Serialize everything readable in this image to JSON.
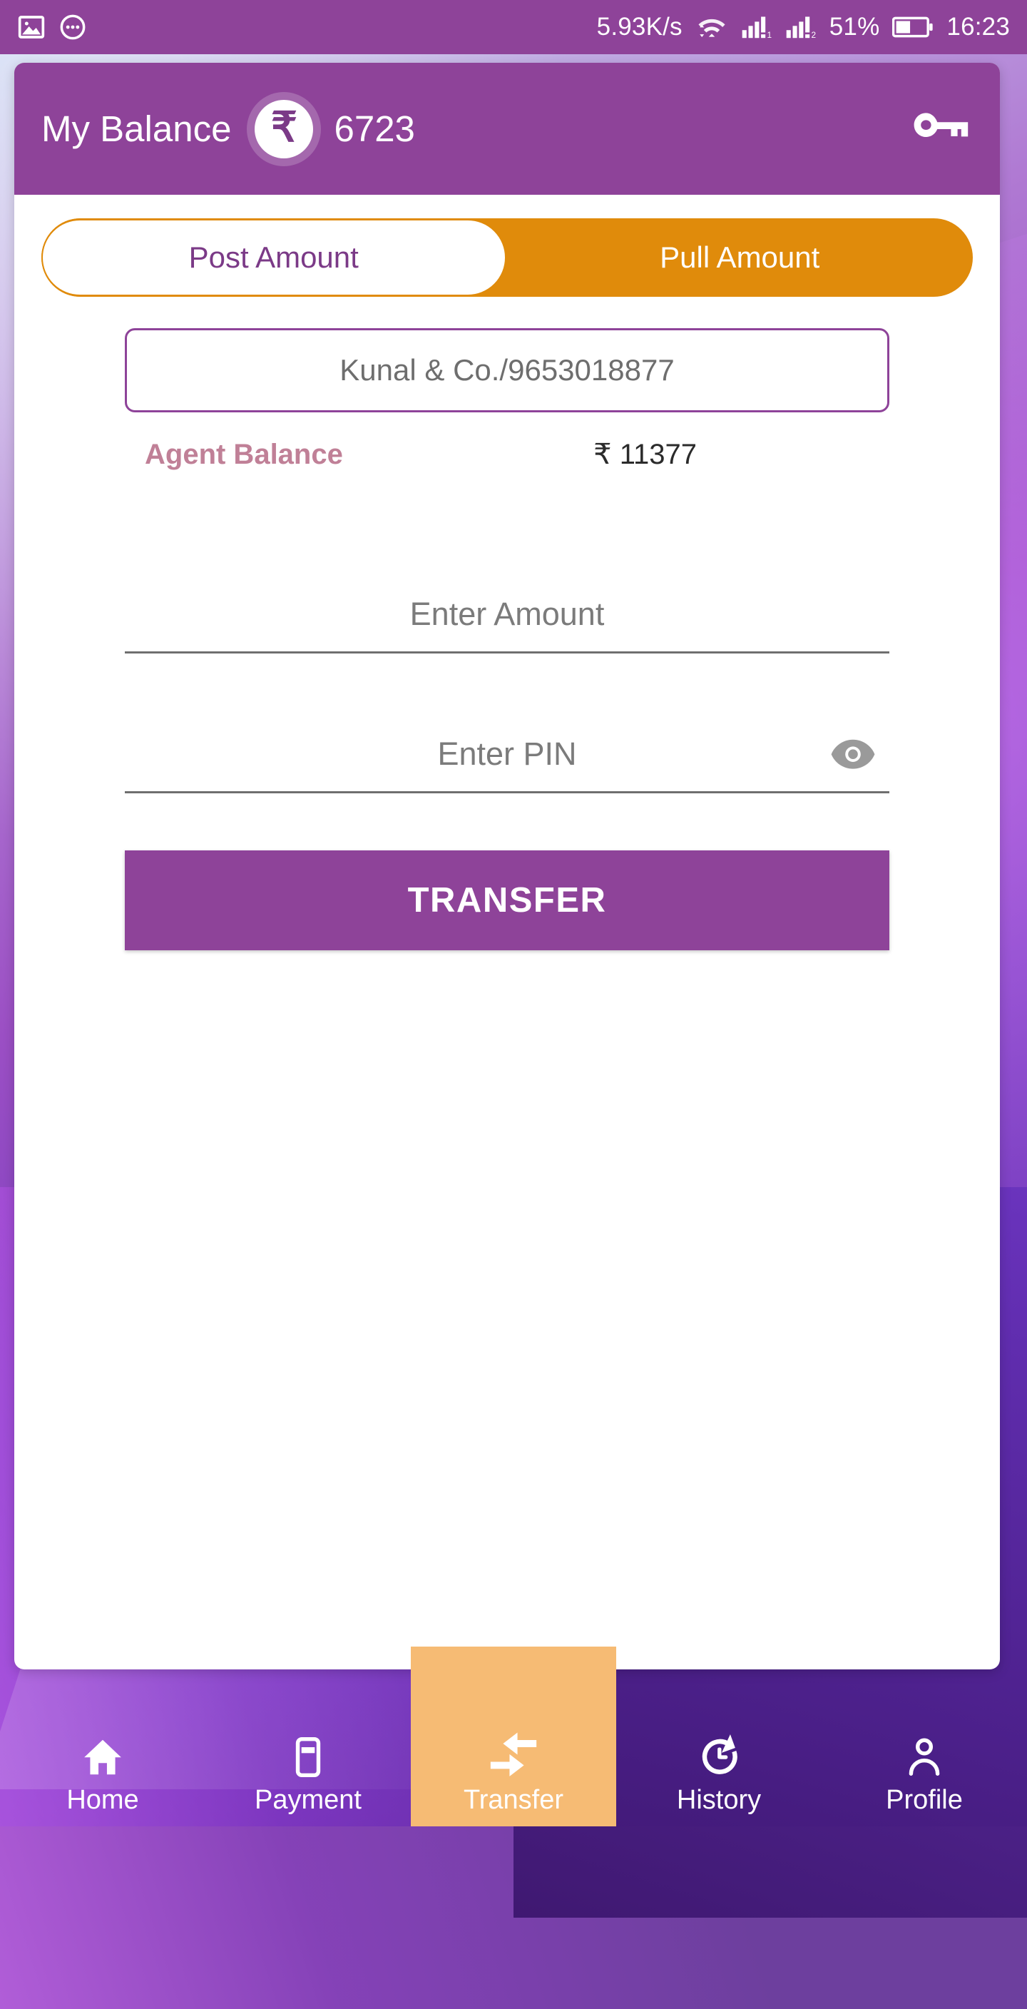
{
  "statusbar": {
    "network_speed": "5.93K/s",
    "battery_percent": "51%",
    "clock": "16:23",
    "icons": {
      "screenshot": "image-icon",
      "more": "more-circle-icon",
      "wifi": "wifi-icon",
      "signal1": "signal-bars-sim1-icon",
      "signal2": "signal-bars-sim2-icon",
      "battery": "battery-half-icon"
    }
  },
  "appbar": {
    "title": "My Balance",
    "currency_symbol": "₹",
    "balance": "6723",
    "key_icon": "key-icon",
    "accent": "#8e4399"
  },
  "tabs": {
    "items": [
      {
        "label": "Post Amount",
        "active": true
      },
      {
        "label": "Pull Amount",
        "active": false
      }
    ],
    "track_color": "#e08b0b",
    "active_text_color": "#7b3a87"
  },
  "agent": {
    "selected": "Kunal & Co./9653018877",
    "balance_label": "Agent Balance",
    "balance_value": "₹ 11377",
    "balance_label_color": "#c08097"
  },
  "form": {
    "amount": {
      "placeholder": "Enter Amount",
      "value": ""
    },
    "pin": {
      "placeholder": "Enter PIN",
      "value": "",
      "toggle_icon": "eye-visibility-icon"
    },
    "submit_label": "TRANSFER"
  },
  "bottomnav": {
    "items": [
      {
        "label": "Home",
        "icon": "home-icon",
        "active": false
      },
      {
        "label": "Payment",
        "icon": "credit-card-icon",
        "active": false
      },
      {
        "label": "Transfer",
        "icon": "transfer-arrows-icon",
        "active": true
      },
      {
        "label": "History",
        "icon": "history-clock-icon",
        "active": false
      },
      {
        "label": "Profile",
        "icon": "person-icon",
        "active": false
      }
    ],
    "active_color": "#f6bb74"
  }
}
